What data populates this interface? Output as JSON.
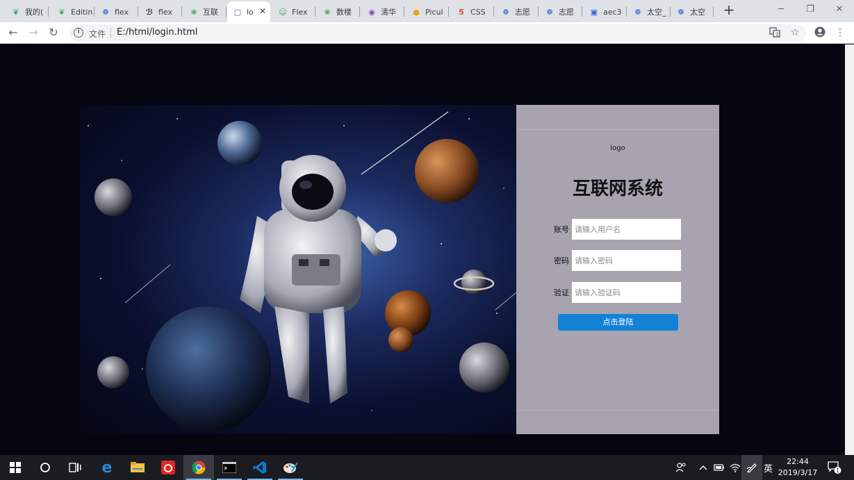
{
  "browser": {
    "tabs": [
      {
        "label": "我的(",
        "icon": "leaf-icon",
        "color": "#3ba55c"
      },
      {
        "label": "Editin",
        "icon": "leaf-icon",
        "color": "#3ba55c"
      },
      {
        "label": "flex ",
        "icon": "paw-icon",
        "color": "#2f64d6"
      },
      {
        "label": "flex ",
        "icon": "feather-icon",
        "color": "#333333"
      },
      {
        "label": "互联",
        "icon": "sprout-icon",
        "color": "#3ba55c"
      },
      {
        "label": "lo",
        "icon": "page-icon",
        "color": "#5f6368",
        "active": true
      },
      {
        "label": "Flex ",
        "icon": "smiley-icon",
        "color": "#3ba55c"
      },
      {
        "label": "数楼",
        "icon": "sprout-icon",
        "color": "#3ba55c"
      },
      {
        "label": "清华",
        "icon": "circle-icon",
        "color": "#8e44ad"
      },
      {
        "label": "Picul",
        "icon": "balloon-icon",
        "color": "#f0a202"
      },
      {
        "label": "CSS",
        "icon": "html5-icon",
        "color": "#e34c26"
      },
      {
        "label": "志愿",
        "icon": "paw-icon",
        "color": "#2f64d6"
      },
      {
        "label": "志愿",
        "icon": "paw-icon",
        "color": "#2f64d6"
      },
      {
        "label": "aec3",
        "icon": "paw-box-icon",
        "color": "#2f64d6"
      },
      {
        "label": "太空_",
        "icon": "paw-icon",
        "color": "#2f64d6"
      },
      {
        "label": "太空",
        "icon": "paw-icon",
        "color": "#2f64d6"
      }
    ],
    "close_glyph": "✕",
    "new_tab_glyph": "+",
    "scheme_label": "文件",
    "url": "E:/html/login.html"
  },
  "login": {
    "logo_text": "logo",
    "title": "互联网系统",
    "username_label": "账号",
    "username_placeholder": "请输入用户名",
    "password_label": "密码",
    "password_placeholder": "请输入密码",
    "captcha_label": "验证",
    "captcha_placeholder": "请输入验证码",
    "submit_label": "点击登陆"
  },
  "taskbar": {
    "ime_label": "英",
    "time": "22:44",
    "date": "2019/3/17",
    "notification_count": "1"
  },
  "colors": {
    "page_bg": "#05060f",
    "panel_bg": "#a7a4af",
    "button_bg": "#1282d6"
  }
}
